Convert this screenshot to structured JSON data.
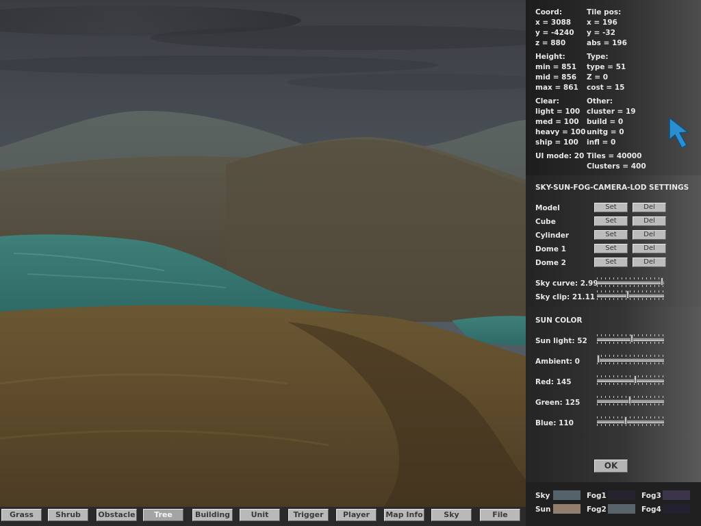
{
  "info": {
    "coord": {
      "label": "Coord:",
      "x": "x = 3088",
      "y": "y = -4240",
      "z": "z = 880"
    },
    "tile": {
      "label": "Tile pos:",
      "x": "x = 196",
      "y": "y = -32",
      "abs": "abs = 196"
    },
    "height": {
      "label": "Height:",
      "min": "min = 851",
      "mid": "mid = 856",
      "max": "max = 861"
    },
    "type": {
      "label": "Type:",
      "type": "type = 51",
      "z": "Z = 0",
      "cost": "cost = 15"
    },
    "clear": {
      "label": "Clear:",
      "light": "light = 100",
      "med": "med = 100",
      "heavy": "heavy = 100",
      "ship": "ship = 100"
    },
    "other": {
      "label": "Other:",
      "cluster": "cluster = 19",
      "build": "build = 0",
      "unitg": "unitg = 0",
      "infl": "infl = 0"
    },
    "ui_mode": "UI mode: 20",
    "tiles": "Tiles = 40000",
    "clusters": "Clusters = 400"
  },
  "sky_settings": {
    "title": "SKY-SUN-FOG-CAMERA-LOD SETTINGS",
    "set_label": "Set",
    "del_label": "Del",
    "rows": [
      {
        "label": "Model"
      },
      {
        "label": "Cube"
      },
      {
        "label": "Cylinder"
      },
      {
        "label": "Dome 1"
      },
      {
        "label": "Dome 2"
      }
    ],
    "sky_curve": {
      "label": "Sky curve: 2.99",
      "fraction": 0.99
    },
    "sky_clip": {
      "label": "Sky clip: 21.11",
      "fraction": 0.46
    }
  },
  "sun_color": {
    "title": "SUN COLOR",
    "sliders": [
      {
        "label": "Sun light: 52",
        "fraction": 0.52
      },
      {
        "label": "Ambient: 0",
        "fraction": 0.0
      },
      {
        "label": "Red: 145",
        "fraction": 0.57
      },
      {
        "label": "Green: 125",
        "fraction": 0.49
      },
      {
        "label": "Blue: 110",
        "fraction": 0.43
      }
    ],
    "ok_label": "OK"
  },
  "swatches": {
    "sky": {
      "label": "Sky",
      "color": "#56626a"
    },
    "sun": {
      "label": "Sun",
      "color": "#917e6e"
    },
    "fog1": {
      "label": "Fog1",
      "color": "#26232e"
    },
    "fog2": {
      "label": "Fog2",
      "color": "#58646a"
    },
    "fog3": {
      "label": "Fog3",
      "color": "#3c3549"
    },
    "fog4": {
      "label": "Fog4",
      "color": "#232130"
    }
  },
  "toolbar": {
    "active": "Tree",
    "items": [
      "Grass",
      "Shrub",
      "Obstacle",
      "Tree",
      "Building",
      "Unit",
      "Trigger",
      "Player",
      "Map Info",
      "Sky",
      "File"
    ]
  },
  "colors": {
    "cursor": "#2a8ed0",
    "panel_text": "#e8e8e8"
  }
}
